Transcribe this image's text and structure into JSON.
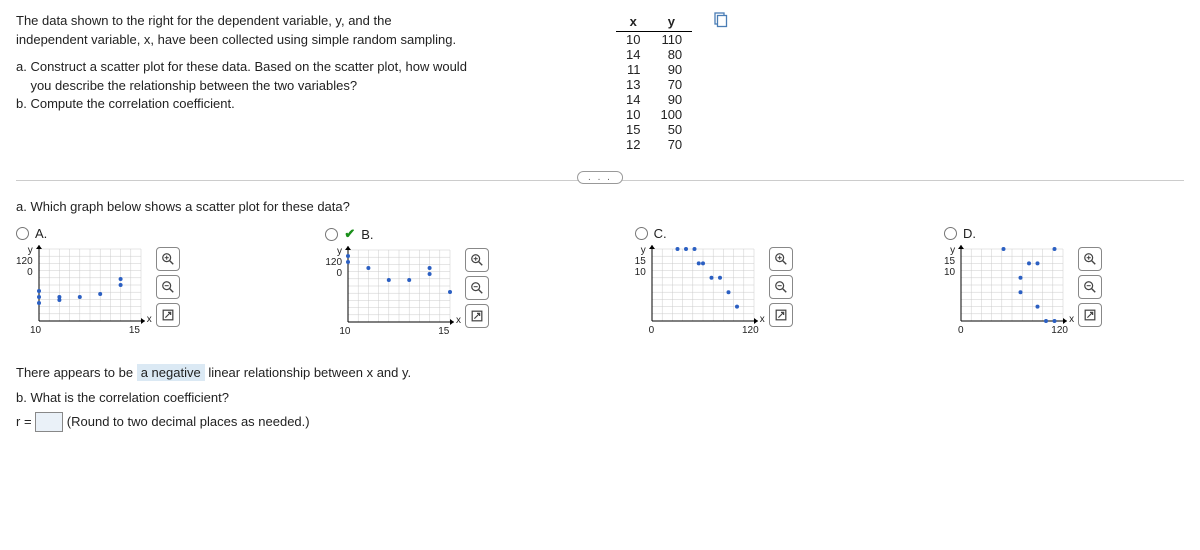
{
  "instructions": {
    "intro1": "The data shown to the right for the dependent variable, y, and the",
    "intro2": "independent variable, x, have been collected using simple random sampling.",
    "a1": "a. Construct a scatter plot for these data. Based on the scatter plot, how would",
    "a2": "    you describe the relationship between the two variables?",
    "b": "b. Compute the correlation coefficient."
  },
  "table": {
    "headers": {
      "x": "x",
      "y": "y"
    },
    "rows": [
      {
        "x": "10",
        "y": "110"
      },
      {
        "x": "14",
        "y": "80"
      },
      {
        "x": "11",
        "y": "90"
      },
      {
        "x": "13",
        "y": "70"
      },
      {
        "x": "14",
        "y": "90"
      },
      {
        "x": "10",
        "y": "100"
      },
      {
        "x": "15",
        "y": "50"
      },
      {
        "x": "12",
        "y": "70"
      }
    ]
  },
  "partA": {
    "question": "a. Which graph below shows a scatter plot for these data?",
    "options": {
      "A": "A.",
      "B": "B.",
      "C": "C.",
      "D": "D."
    },
    "selected": "B"
  },
  "plot_axes": {
    "AB": {
      "ylabel": "y",
      "xlabel": "x",
      "ymax": "120",
      "ymin": "0",
      "xmin": "10",
      "xmax": "15"
    },
    "CD": {
      "ylabel": "y",
      "xlabel": "x",
      "ymax": "15",
      "ymin": "10",
      "xmin": "0",
      "xmax": "120"
    }
  },
  "relationship": {
    "prefix": "There appears to be ",
    "picked": "a negative",
    "suffix": " linear relationship between x and y."
  },
  "partB": {
    "question": "b. What is the correlation coefficient?",
    "r_prefix": "r =",
    "r_value": "",
    "hint": " (Round to two decimal places as needed.)"
  },
  "chart_data": [
    {
      "type": "scatter",
      "option": "A",
      "xlabel": "x",
      "ylabel": "y",
      "xlim": [
        10,
        15
      ],
      "ylim": [
        0,
        120
      ],
      "points": [
        [
          10,
          30
        ],
        [
          10,
          40
        ],
        [
          10,
          50
        ],
        [
          11,
          35
        ],
        [
          11,
          40
        ],
        [
          12,
          40
        ],
        [
          13,
          45
        ],
        [
          14,
          60
        ],
        [
          14,
          70
        ]
      ]
    },
    {
      "type": "scatter",
      "option": "B",
      "xlabel": "x",
      "ylabel": "y",
      "xlim": [
        10,
        15
      ],
      "ylim": [
        0,
        120
      ],
      "points": [
        [
          10,
          110
        ],
        [
          10,
          100
        ],
        [
          11,
          90
        ],
        [
          12,
          70
        ],
        [
          13,
          70
        ],
        [
          14,
          80
        ],
        [
          14,
          90
        ],
        [
          15,
          50
        ]
      ]
    },
    {
      "type": "scatter",
      "option": "C",
      "xlabel": "x",
      "ylabel": "y",
      "xlim": [
        0,
        120
      ],
      "ylim": [
        10,
        15
      ],
      "points": [
        [
          30,
          15
        ],
        [
          40,
          15
        ],
        [
          50,
          15
        ],
        [
          55,
          14
        ],
        [
          60,
          14
        ],
        [
          70,
          13
        ],
        [
          80,
          13
        ],
        [
          90,
          12
        ],
        [
          100,
          11
        ]
      ]
    },
    {
      "type": "scatter",
      "option": "D",
      "xlabel": "x",
      "ylabel": "y",
      "xlim": [
        0,
        120
      ],
      "ylim": [
        10,
        15
      ],
      "points": [
        [
          50,
          15
        ],
        [
          70,
          12
        ],
        [
          70,
          13
        ],
        [
          80,
          14
        ],
        [
          90,
          11
        ],
        [
          90,
          14
        ],
        [
          100,
          10
        ],
        [
          110,
          10
        ],
        [
          110,
          15
        ]
      ]
    }
  ],
  "ellipsis": ". . ."
}
